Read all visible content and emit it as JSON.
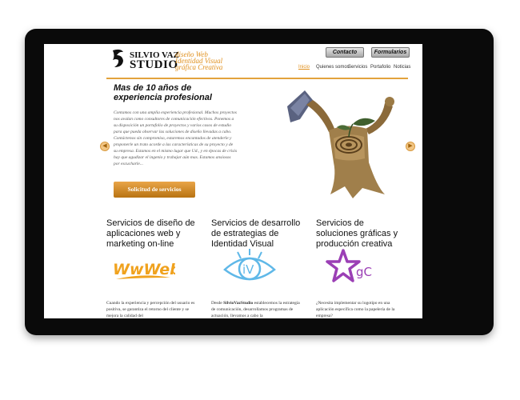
{
  "brand": {
    "name_top": "SILVIO VAZ",
    "name_bottom": "STUDIO",
    "tagline": [
      "diseño Web",
      "Identidad Visual",
      "gráfica Creativa"
    ]
  },
  "top_buttons": [
    "Contacto",
    "Formularios"
  ],
  "nav": [
    "Inicio",
    "Quienes somos",
    "Servicios",
    "Portafolio",
    "Noticias"
  ],
  "hero": {
    "title": "Mas de 10 años de experiencia profesional",
    "body": "Contamos con una amplia experiencia profesional. Muchos proyectos nos avalan como consultores de comunicación efectivos. Ponemos a su disposición un portafolio de proyectos y varios casos de estudio para que pueda observar las soluciones de diseño llevadas a cabo. Contáctenos sin compromiso, estaremos encantados de atenderle y proponerle un trato acorde a las características de su proyecto y de su empresa. Estamos en el mismo lugar que Ud., y en épocas de crisis hay que agudizar el ingenio y trabajar aún mas. Estamos ansiosos por escucharle...",
    "cta": "Solicitud de servicios"
  },
  "services": [
    {
      "title": "Servicios de diseño de aplicaciones web y marketing on-line",
      "logo_text": "WwWeb",
      "text": "Cuando la experiencia y percepción del usuario es positiva, se garantiza el retorno del cliente y se mejora la calidad del"
    },
    {
      "title": "Servicios de desarrollo de estrategias de Identidad Visual",
      "logo_text": "iV",
      "text_lead": "Desde ",
      "text_strong": "SilvioVazStudio",
      "text": " establecemos la estrategia de comunicación, desarrollamos programas de actuación, llevamos a cabo la"
    },
    {
      "title": "Servicios de soluciones gráficas y producción creativa",
      "logo_text": "gC",
      "text": "¿Necesita implementar su logotipo en una aplicación específica como la papelería de la empresa?"
    }
  ],
  "colors": {
    "accent": "#e0901d",
    "web_logo": "#f0a21e",
    "iv_logo": "#5fb8e8",
    "gc_logo": "#9b3fb5"
  }
}
